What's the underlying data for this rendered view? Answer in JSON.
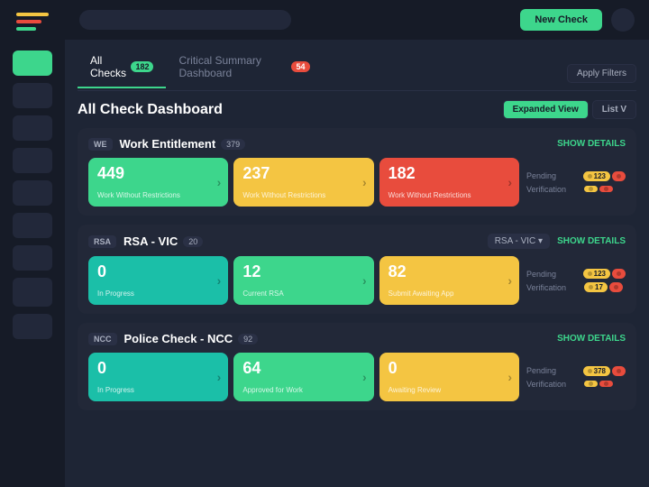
{
  "sidebar": {
    "logo_bars": [
      "bar1",
      "bar2",
      "bar3"
    ],
    "nav_items": [
      {
        "id": "nav-1",
        "active": true
      },
      {
        "id": "nav-2",
        "active": false
      },
      {
        "id": "nav-3",
        "active": false
      },
      {
        "id": "nav-4",
        "active": false
      },
      {
        "id": "nav-5",
        "active": false
      },
      {
        "id": "nav-6",
        "active": false
      },
      {
        "id": "nav-7",
        "active": false
      },
      {
        "id": "nav-8",
        "active": false
      },
      {
        "id": "nav-9",
        "active": false
      }
    ]
  },
  "topbar": {
    "button_label": "New Check",
    "apply_filter_label": "Apply Filters"
  },
  "tabs": [
    {
      "id": "all-checks",
      "label": "All Checks",
      "badge": "182",
      "badge_color": "green",
      "active": true
    },
    {
      "id": "critical-summary",
      "label": "Critical Summary Dashboard",
      "badge": "54",
      "badge_color": "red",
      "active": false
    }
  ],
  "dashboard": {
    "title": "All Check Dashboard",
    "view_buttons": [
      {
        "id": "expanded",
        "label": "Expanded View",
        "primary": true
      },
      {
        "id": "list",
        "label": "List V",
        "primary": false
      }
    ]
  },
  "checks": [
    {
      "id": "work-entitlement",
      "code": "WE",
      "name": "Work Entitlement",
      "count": "379",
      "dropdown": null,
      "show_details": "SHOW DETAILS",
      "metrics": [
        {
          "value": "449",
          "label": "Work Without Restrictions",
          "color": "green"
        },
        {
          "value": "237",
          "label": "Work Without Restrictions",
          "color": "yellow"
        },
        {
          "value": "182",
          "label": "Work Without Restrictions",
          "color": "red"
        }
      ],
      "pending": {
        "label": "Pending",
        "badges": [
          {
            "value": "123",
            "color": "yellow"
          },
          {
            "value": "",
            "color": "red"
          }
        ]
      },
      "verification": {
        "label": "Verification",
        "badges": [
          {
            "value": "",
            "color": "yellow"
          },
          {
            "value": "",
            "color": "red"
          }
        ]
      }
    },
    {
      "id": "rsa-vic",
      "code": "RSA",
      "name": "RSA - VIC",
      "count": "20",
      "dropdown": "RSA - VIC",
      "show_details": "SHOW DETAILS",
      "metrics": [
        {
          "value": "0",
          "label": "In Progress",
          "color": "teal"
        },
        {
          "value": "12",
          "label": "Current RSA",
          "color": "green"
        },
        {
          "value": "82",
          "label": "Submit Awaiting App",
          "color": "yellow"
        }
      ],
      "pending": {
        "label": "Pending",
        "badges": [
          {
            "value": "123",
            "color": "yellow"
          },
          {
            "value": "",
            "color": "red"
          }
        ]
      },
      "verification": {
        "label": "Verification",
        "badges": [
          {
            "value": "17",
            "color": "yellow"
          },
          {
            "value": "",
            "color": "red"
          }
        ]
      }
    },
    {
      "id": "police-check-ncc",
      "code": "NCC",
      "name": "Police Check - NCC",
      "count": "92",
      "dropdown": null,
      "show_details": "SHOW DETAILS",
      "metrics": [
        {
          "value": "0",
          "label": "In Progress",
          "color": "teal"
        },
        {
          "value": "64",
          "label": "Approved for Work",
          "color": "green"
        },
        {
          "value": "0",
          "label": "Awaiting Review",
          "color": "yellow"
        }
      ],
      "pending": {
        "label": "Pending",
        "badges": [
          {
            "value": "378",
            "color": "yellow"
          },
          {
            "value": "",
            "color": "red"
          }
        ]
      },
      "verification": {
        "label": "Verification",
        "badges": [
          {
            "value": "",
            "color": "yellow"
          },
          {
            "value": "",
            "color": "red"
          }
        ]
      }
    }
  ]
}
